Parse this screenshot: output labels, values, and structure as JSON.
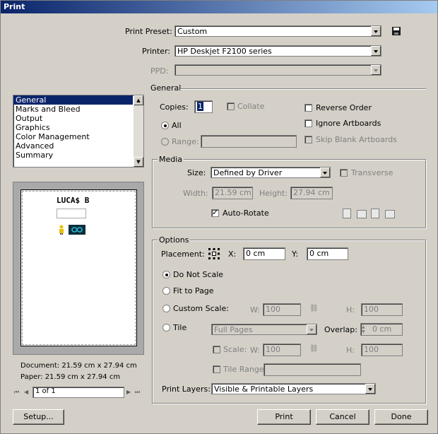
{
  "window": {
    "title": "Print"
  },
  "preset": {
    "label": "Print Preset:",
    "value": "Custom"
  },
  "printer": {
    "label": "Printer:",
    "value": "HP Deskjet F2100 series"
  },
  "ppd": {
    "label": "PPD:",
    "value": ""
  },
  "section_title": "General",
  "sidebar": {
    "items": [
      {
        "label": "General",
        "selected": true
      },
      {
        "label": "Marks and Bleed"
      },
      {
        "label": "Output"
      },
      {
        "label": "Graphics"
      },
      {
        "label": "Color Management"
      },
      {
        "label": "Advanced"
      },
      {
        "label": "Summary"
      }
    ]
  },
  "preview": {
    "logo_text": "LUCA$ B",
    "document_size": "Document: 21.59 cm x 27.94 cm",
    "paper_size": "Paper: 21.59 cm x 27.94 cm",
    "page_indicator": "1 of 1"
  },
  "general": {
    "copies_label": "Copies:",
    "copies_value": "1",
    "collate_label": "Collate",
    "all_label": "All",
    "range_label": "Range:",
    "range_value": "",
    "reverse_order_label": "Reverse Order",
    "ignore_artboards_label": "Ignore Artboards",
    "skip_blank_label": "Skip Blank Artboards"
  },
  "media": {
    "group_label": "Media",
    "size_label": "Size:",
    "size_value": "Defined by Driver",
    "transverse_label": "Transverse",
    "width_label": "Width:",
    "width_value": "21.59 cm",
    "height_label": "Height:",
    "height_value": "27.94 cm",
    "auto_rotate_label": "Auto-Rotate"
  },
  "options": {
    "group_label": "Options",
    "placement_label": "Placement:",
    "x_label": "X:",
    "x_value": "0 cm",
    "y_label": "Y:",
    "y_value": "0 cm",
    "do_not_scale_label": "Do Not Scale",
    "fit_to_page_label": "Fit to Page",
    "custom_scale_label": "Custom Scale:",
    "w_label": "W:",
    "w_value": "100",
    "h_label": "H:",
    "h_value": "100",
    "tile_label": "Tile",
    "tile_value": "Full Pages",
    "overlap_label": "Overlap:",
    "overlap_value": "0 cm",
    "scale_label": "Scale:",
    "scale_w_label": "W:",
    "scale_w_value": "100",
    "scale_h_label": "H:",
    "scale_h_value": "100",
    "tile_range_label": "Tile Range:",
    "tile_range_value": "",
    "print_layers_label": "Print Layers:",
    "print_layers_value": "Visible & Printable Layers"
  },
  "buttons": {
    "setup": "Setup...",
    "print": "Print",
    "cancel": "Cancel",
    "done": "Done"
  }
}
